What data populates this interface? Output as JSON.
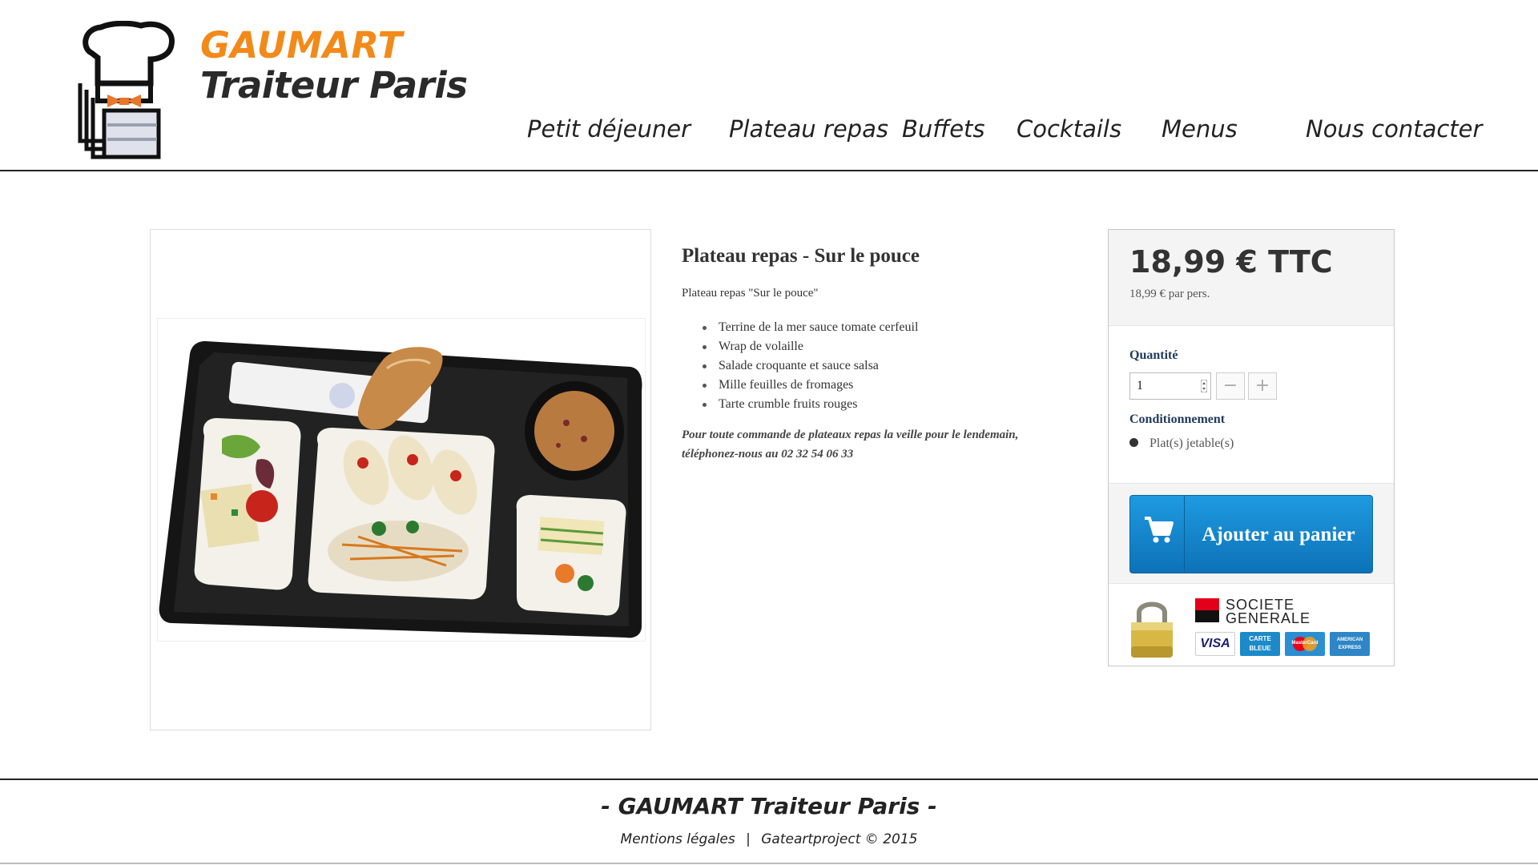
{
  "brand": {
    "line1": "GAUMART",
    "line2": "Traiteur Paris",
    "colors": {
      "orange": "#f28a1a",
      "dark": "#2a2a2a"
    }
  },
  "nav": {
    "items": [
      {
        "label": "Petit déjeuner"
      },
      {
        "label": "Plateau repas"
      },
      {
        "label": "Buffets"
      },
      {
        "label": "Cocktails"
      },
      {
        "label": "Menus"
      },
      {
        "label": "Nous contacter"
      }
    ]
  },
  "product": {
    "image_icon": "lunch-tray-photo",
    "title": "Plateau repas - Sur le pouce",
    "intro": "Plateau repas \"Sur le pouce\"",
    "items": [
      "Terrine de la mer sauce tomate cerfeuil",
      "Wrap de volaille",
      "Salade croquante et sauce salsa",
      "Mille feuilles de fromages",
      "Tarte crumble fruits rouges"
    ],
    "note": "Pour toute commande de plateaux repas  la veille pour le lendemain, téléphonez-nous au 02 32 54 06 33"
  },
  "buy": {
    "price": "18,99 € TTC",
    "price_per": "18,99 € par pers.",
    "quantity_label": "Quantité",
    "quantity_value": "1",
    "minus": "−",
    "plus": "+",
    "packaging_label": "Conditionnement",
    "packaging_option": "Plat(s) jetable(s)",
    "cart_button": "Ajouter au panier",
    "cart_icon": "shopping-cart-icon",
    "button_color": "#1485cc",
    "bank": "SOCIETE GENERALE",
    "cards": [
      "VISA",
      "CARTE BLEUE",
      "MasterCard",
      "AMERICAN EXPRESS"
    ]
  },
  "footer": {
    "title": "- GAUMART Traiteur Paris -",
    "legal": "Mentions légales",
    "separator": "|",
    "credit": "Gateartproject © 2015"
  }
}
